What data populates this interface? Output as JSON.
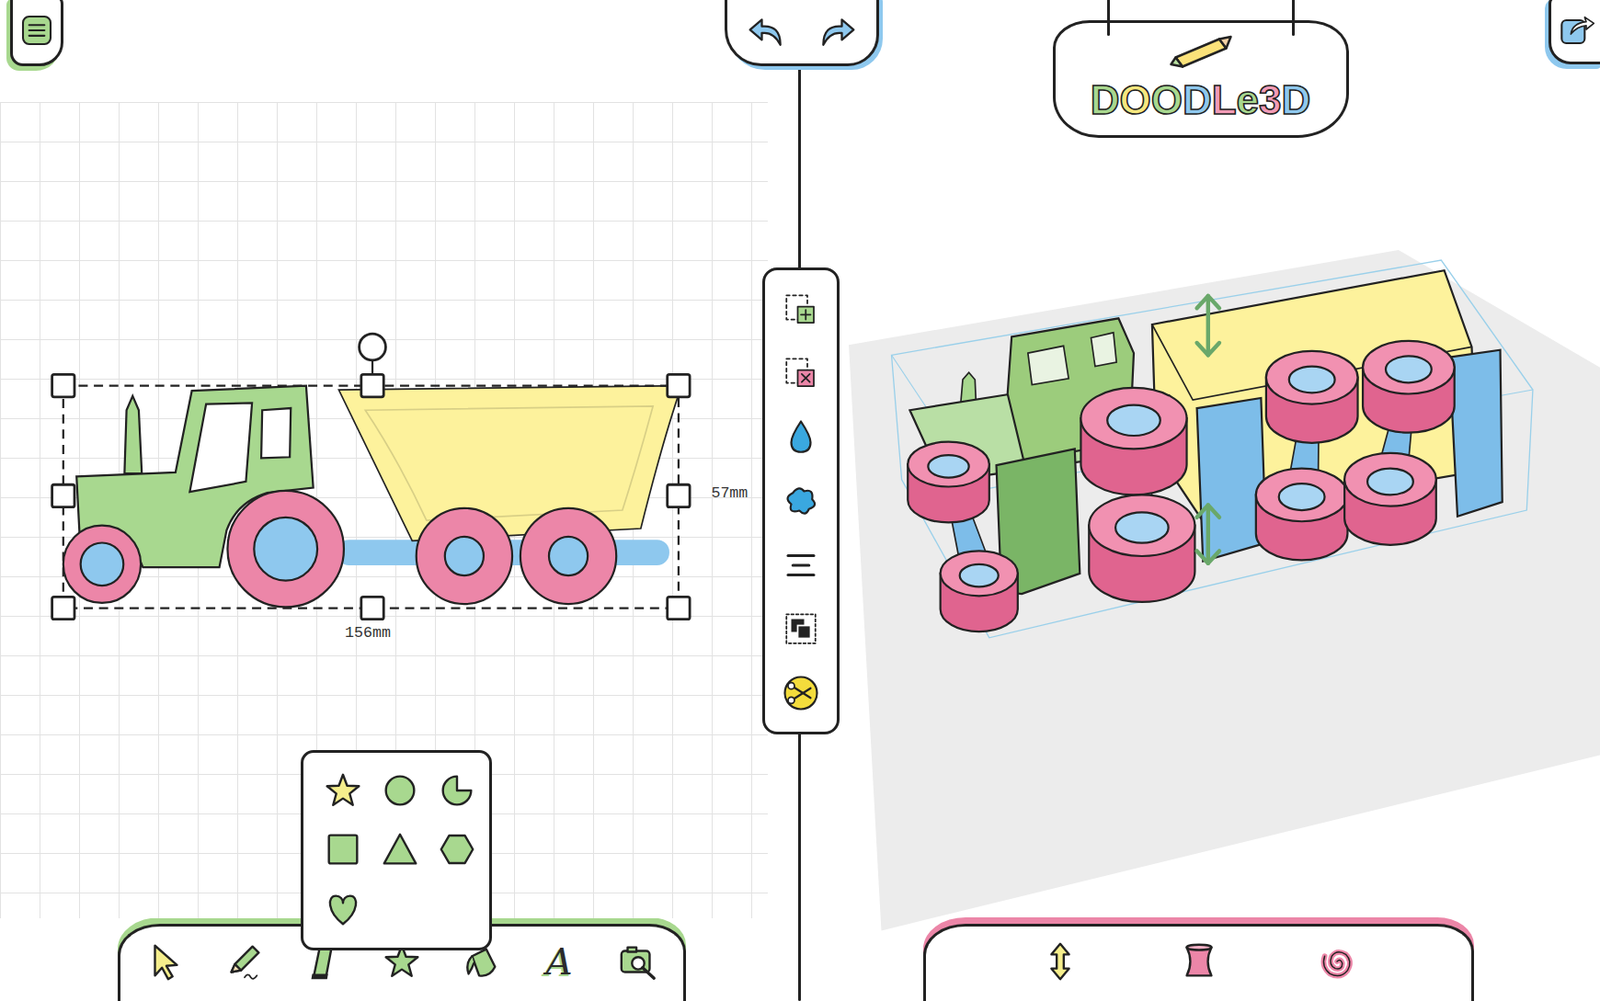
{
  "logo": {
    "letters": [
      {
        "char": "D",
        "color": "#a8d88f"
      },
      {
        "char": "O",
        "color": "#f5e77e"
      },
      {
        "char": "O",
        "color": "#a8d88f"
      },
      {
        "char": "D",
        "color": "#8ec8ee"
      },
      {
        "char": "L",
        "color": "#f29bb6"
      },
      {
        "char": "e",
        "color": "#a8d88f"
      },
      {
        "char": "3",
        "color": "#f29bb6"
      },
      {
        "char": "D",
        "color": "#8ec8ee"
      }
    ]
  },
  "selection": {
    "height": "57mm",
    "width": "156mm"
  },
  "shape_menu": {
    "open": true
  },
  "text_tool": {
    "glyph": "A"
  }
}
